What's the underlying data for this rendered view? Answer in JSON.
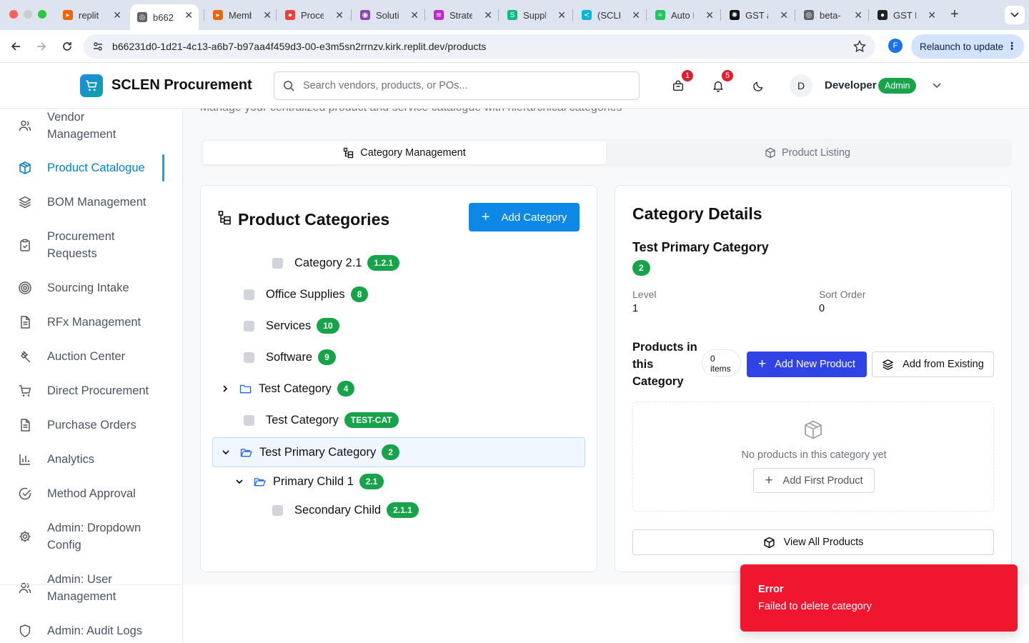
{
  "browser": {
    "tabs": [
      {
        "title": "replit",
        "color": "#f26207",
        "glyph": "▸"
      },
      {
        "title": "b662",
        "color": "#5f6368",
        "glyph": "◎"
      },
      {
        "title": "Memb",
        "color": "#f26207",
        "glyph": "▸"
      },
      {
        "title": "Proce",
        "color": "#ea4335",
        "glyph": "●"
      },
      {
        "title": "Soluti",
        "color": "#8e44ad",
        "glyph": "◉"
      },
      {
        "title": "Strate",
        "color": "#c026d3",
        "glyph": "≋"
      },
      {
        "title": "Suppl",
        "color": "#10b981",
        "glyph": "S"
      },
      {
        "title": "(SCLE",
        "color": "#06b6d4",
        "glyph": "≺"
      },
      {
        "title": "Auto I",
        "color": "#22c55e",
        "glyph": "≈"
      },
      {
        "title": "GST a",
        "color": "#111111",
        "glyph": "✺"
      },
      {
        "title": "beta-",
        "color": "#5f6368",
        "glyph": "◎"
      },
      {
        "title": "GST F",
        "color": "#222222",
        "glyph": "●"
      }
    ],
    "url": "b66231d0-1d21-4c13-a6b7-b97aa4f459d3-00-e3m5sn2rrnzv.kirk.replit.dev/products",
    "profile_initial": "F",
    "relaunch_label": "Relaunch to update"
  },
  "header": {
    "app_title": "SCLEN Procurement",
    "search_placeholder": "Search vendors, products, or POs...",
    "cart_count": "1",
    "notification_count": "5",
    "avatar_initial": "D",
    "user_name": "Developer",
    "user_role": "Admin"
  },
  "sidebar": {
    "items": [
      {
        "label": "Vendor Management",
        "icon": "users-icon"
      },
      {
        "label": "Product Catalogue",
        "icon": "box-icon",
        "active": true
      },
      {
        "label": "BOM Management",
        "icon": "layers-icon"
      },
      {
        "label": "Procurement Requests",
        "icon": "clipboard-icon"
      },
      {
        "label": "Sourcing Intake",
        "icon": "target-icon"
      },
      {
        "label": "RFx Management",
        "icon": "file-text-icon"
      },
      {
        "label": "Auction Center",
        "icon": "gavel-icon"
      },
      {
        "label": "Direct Procurement",
        "icon": "cart-icon"
      },
      {
        "label": "Purchase Orders",
        "icon": "file-icon"
      },
      {
        "label": "Analytics",
        "icon": "bar-chart-icon"
      },
      {
        "label": "Method Approval",
        "icon": "check-circle-icon"
      },
      {
        "label": "Admin: Dropdown Config",
        "icon": "gear-icon"
      },
      {
        "label": "Admin: User Management",
        "icon": "users-icon"
      },
      {
        "label": "Admin: Audit Logs",
        "icon": "shield-icon"
      }
    ]
  },
  "main": {
    "subtitle": "Manage your centralized product and service catalogue with hierarchical categories",
    "tabs": [
      {
        "label": "Category Management",
        "active": true
      },
      {
        "label": "Product Listing",
        "active": false
      }
    ]
  },
  "categories": {
    "title": "Product Categories",
    "add_label": "Add Category",
    "tree": [
      {
        "name": "Category 2.1",
        "code": "1.2.1",
        "type": "leaf"
      },
      {
        "name": "Office Supplies",
        "code": "8",
        "type": "leaf"
      },
      {
        "name": "Services",
        "code": "10",
        "type": "leaf"
      },
      {
        "name": "Software",
        "code": "9",
        "type": "leaf"
      },
      {
        "name": "Test Category",
        "code": "4",
        "type": "collapsed"
      },
      {
        "name": "Test Category",
        "code": "TEST-CAT",
        "type": "leaf"
      },
      {
        "name": "Test Primary Category",
        "code": "2",
        "type": "expanded",
        "selected": true
      },
      {
        "name": "Primary Child 1",
        "code": "2.1",
        "type": "expanded"
      },
      {
        "name": "Secondary Child",
        "code": "2.1.1",
        "type": "leaf"
      }
    ]
  },
  "details": {
    "title": "Category Details",
    "name": "Test Primary Category",
    "code": "2",
    "level_label": "Level",
    "level_value": "1",
    "sort_label": "Sort Order",
    "sort_value": "0",
    "products_title": "Products in this Category",
    "items_count": "0",
    "items_word": "items",
    "add_new_label": "Add New Product",
    "add_existing_label": "Add from Existing",
    "empty_text": "No products in this category yet",
    "add_first_label": "Add First Product",
    "view_all_label": "View All Products"
  },
  "toast": {
    "title": "Error",
    "message": "Failed to delete category"
  },
  "colors": {
    "accent": "#0d88e6",
    "badge_green": "#16a34a",
    "error_red": "#f11630",
    "indigo": "#2f43e6"
  }
}
